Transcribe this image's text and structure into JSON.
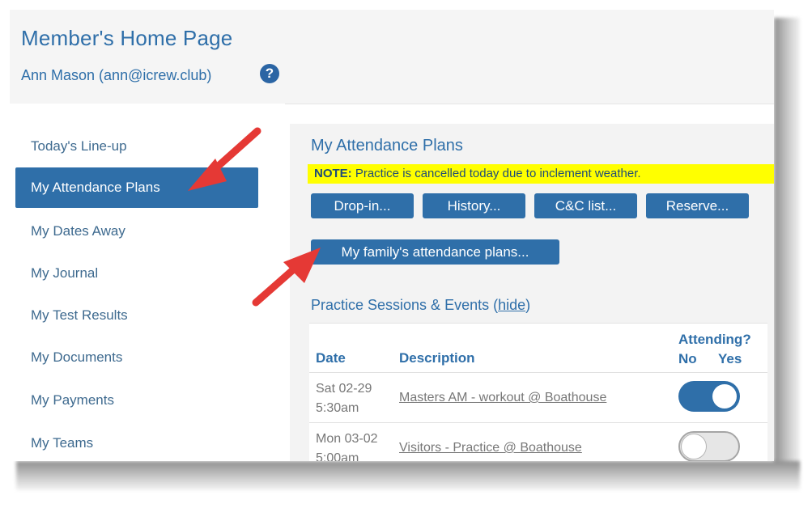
{
  "header": {
    "title": "Member's Home Page",
    "user": "Ann Mason (ann@icrew.club)",
    "help_glyph": "?"
  },
  "sidebar": {
    "items": [
      {
        "label": "Today's Line-up"
      },
      {
        "label": "My Attendance Plans"
      },
      {
        "label": "My Dates Away"
      },
      {
        "label": "My Journal"
      },
      {
        "label": "My Test Results"
      },
      {
        "label": "My Documents"
      },
      {
        "label": "My Payments"
      },
      {
        "label": "My Teams"
      }
    ],
    "active_index": 1
  },
  "main": {
    "title": "My Attendance Plans",
    "note_label": "NOTE:",
    "note_text": "Practice is cancelled today due to inclement weather.",
    "buttons": {
      "dropin": "Drop-in...",
      "history": "History...",
      "cc_list": "C&C list...",
      "reserve": "Reserve...",
      "family": "My family's attendance plans..."
    },
    "sessions": {
      "title": "Practice Sessions & Events (",
      "hide_link": "hide",
      "title_close": ")",
      "headers": {
        "date": "Date",
        "description": "Description",
        "attending": "Attending?",
        "no": "No",
        "yes": "Yes"
      },
      "rows": [
        {
          "date": "Sat 02-29",
          "time": "5:30am",
          "description": "Masters AM - workout @ Boathouse",
          "attending": true
        },
        {
          "date": "Mon 03-02",
          "time": "5:00am",
          "description": "Visitors - Practice @ Boathouse",
          "attending": false
        }
      ]
    }
  },
  "colors": {
    "brand_blue": "#2f6fa9",
    "note_highlight": "#ffff00",
    "annotation_arrow": "#e53935"
  },
  "icons": [
    "help-icon",
    "annotation-arrow-icon"
  ]
}
